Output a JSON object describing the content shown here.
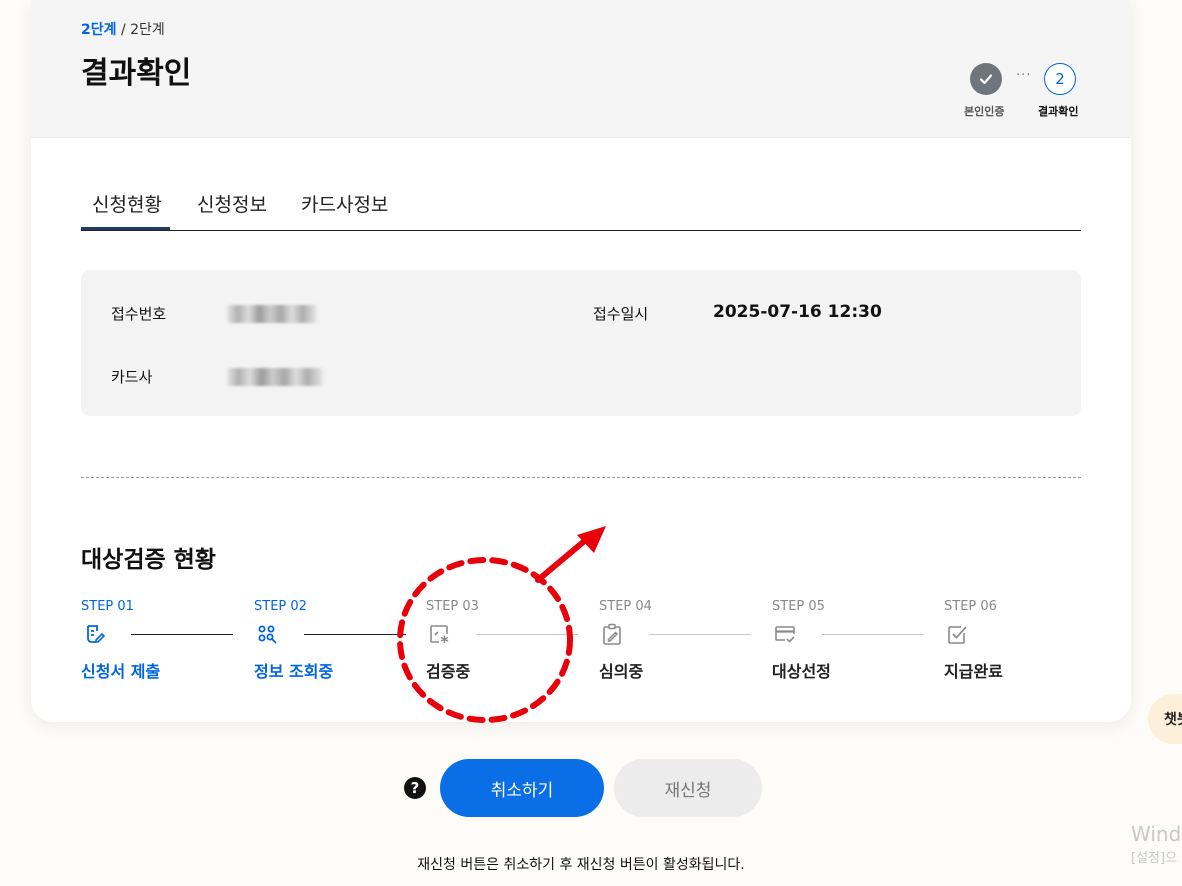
{
  "breadcrumb": {
    "current": "2단계",
    "separator": " / ",
    "total": "2단계"
  },
  "page_title": "결과확인",
  "progress": {
    "steps": [
      {
        "label": "본인인증",
        "status": "done",
        "icon": "check-icon"
      },
      {
        "label": "결과확인",
        "status": "current",
        "number": "2"
      }
    ],
    "dots": "···"
  },
  "tabs": [
    {
      "label": "신청현황",
      "active": true
    },
    {
      "label": "신청정보",
      "active": false
    },
    {
      "label": "카드사정보",
      "active": false
    }
  ],
  "info": {
    "receipt_no_label": "접수번호",
    "receipt_no_value": "",
    "receipt_date_label": "접수일시",
    "receipt_date_value": "2025-07-16 12:30",
    "card_company_label": "카드사",
    "card_company_value": ""
  },
  "section_title": "대상검증 현황",
  "verification_steps": [
    {
      "no": "STEP 01",
      "name": "신청서 제출",
      "status": "active",
      "icon": "application-form-icon"
    },
    {
      "no": "STEP 02",
      "name": "정보 조회중",
      "status": "active",
      "icon": "info-lookup-icon"
    },
    {
      "no": "STEP 03",
      "name": "검증중",
      "status": "pending",
      "icon": "verification-icon"
    },
    {
      "no": "STEP 04",
      "name": "심의중",
      "status": "pending",
      "icon": "clipboard-edit-icon"
    },
    {
      "no": "STEP 05",
      "name": "대상선정",
      "status": "pending",
      "icon": "card-check-icon"
    },
    {
      "no": "STEP 06",
      "name": "지급완료",
      "status": "pending",
      "icon": "checkbox-icon"
    }
  ],
  "buttons": {
    "help": "?",
    "cancel": "취소하기",
    "reapply": "재신청"
  },
  "notice": "재신청 버튼은 취소하기 후 재신청 버튼이 활성화됩니다.",
  "chatbot": {
    "label": "챗봇"
  },
  "watermark": {
    "line1": "Windo",
    "line2": "[설정]으"
  },
  "colors": {
    "accent": "#0066dd",
    "annotation": "#e8000b",
    "primary_button": "#0a6ee6"
  }
}
